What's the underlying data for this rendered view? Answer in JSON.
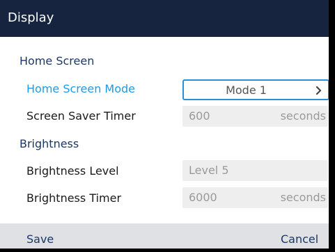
{
  "title": "Display",
  "sections": {
    "home_screen": {
      "heading": "Home Screen",
      "mode": {
        "label": "Home Screen Mode",
        "value": "Mode 1"
      },
      "saver": {
        "label": "Screen Saver Timer",
        "value": "600",
        "unit": "seconds"
      }
    },
    "brightness": {
      "heading": "Brightness",
      "level": {
        "label": "Brightness Level",
        "value": "Level 5"
      },
      "timer": {
        "label": "Brightness Timer",
        "value": "6000",
        "unit": "seconds"
      }
    }
  },
  "softkeys": {
    "left": "Save",
    "right": "Cancel"
  },
  "colors": {
    "title_bar": "#16243f",
    "focus": "#1e9be6",
    "softkey_bar": "#dfe1e5"
  },
  "icons": {
    "mode_selector": "chevron-right-icon"
  }
}
